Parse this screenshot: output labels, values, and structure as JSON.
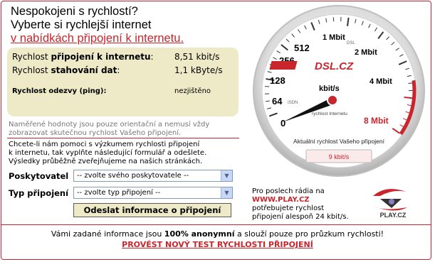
{
  "heading": {
    "line1": "Nespokojeni s rychlostí?",
    "line2": "Vyberte si rychlejší internet",
    "line3": "v nabídkách připojení k internetu."
  },
  "stats": {
    "connection_prefix": "Rychlost ",
    "connection_label": "připojení k internetu",
    "connection_suffix": ":",
    "connection_value": "8,51 kbit/s",
    "download_prefix": "Rychlost ",
    "download_label": "stahování dat",
    "download_suffix": ":",
    "download_value": "1,1 kByte/s",
    "ping_label": "Rychlost odezvy (ping):",
    "ping_value": "nezjištěno"
  },
  "disclaimer": {
    "line1": "Naměřené hodnoty jsou pouze orientační a nemusí vždy",
    "line2": "zobrazovat skutečnou rychlost Vašeho připojení."
  },
  "form": {
    "intro1": "Chcete-li nám pomoci s výzkumem rychlosti připojení",
    "intro2": "k internetu, tak vyplňte následující formulář a odešlete.",
    "intro3": "Výsledky průběžně zveřejňujeme na našich stránkách.",
    "provider_label": "Poskytovatel",
    "provider_value": "-- zvolte svého poskytovatele --",
    "type_label": "Typ připojení",
    "type_value": "-- zvolte typ připojení --",
    "submit_label": "Odeslat informace o připojení"
  },
  "radio": {
    "line1": "Pro poslech rádia na",
    "site": "WWW.PLAY.CZ",
    "line3": "potřebujete rychlost",
    "line4": "připojení alespoň 24 kbit/s.",
    "logo_text": "PLAY.CZ"
  },
  "gauge": {
    "logo": "DSL.CZ",
    "unit": "kbit/s",
    "unit_sub": "rychlost Internetu",
    "caption": "Aktuální rychlost Vašeho připojení",
    "readout": "9 kbit/s",
    "labels": {
      "l0": "0",
      "l64": "64",
      "l128": "128",
      "l256": "256",
      "l512": "512",
      "l1m": "1 Mbit",
      "l2m": "2 Mbit",
      "l4m": "4 Mbit",
      "l8m": "8 Mbit",
      "isdn": "ISDN",
      "dsl": "DSL"
    },
    "accent": "#c8252c"
  },
  "footer": {
    "text_pre": "Vámi zadané informace jsou ",
    "text_bold": "100% anonymní",
    "text_post": " a slouží pouze pro průzkum rychlosti!",
    "retest_label": "PROVÉST NOVÝ TEST RYCHLOSTI PŘIPOJENÍ"
  }
}
